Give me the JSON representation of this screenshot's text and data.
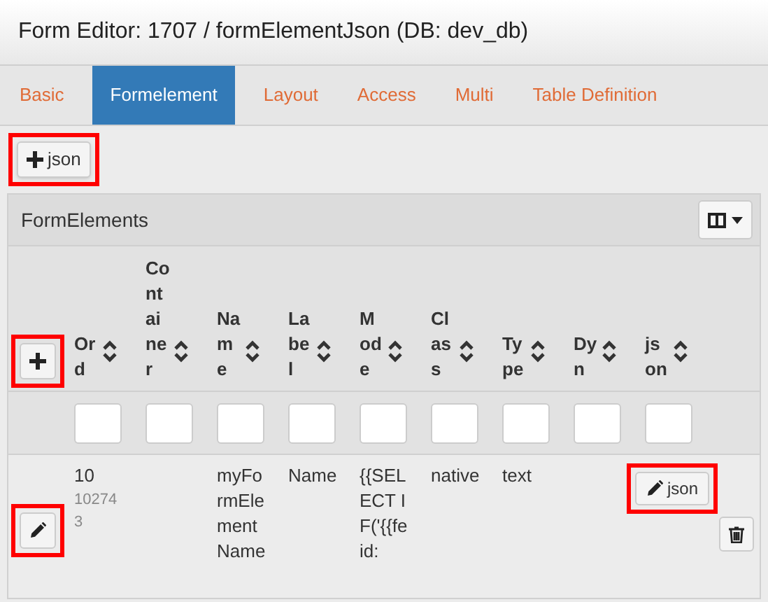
{
  "window": {
    "title": "Form Editor: 1707 / formElementJson (DB: dev_db)"
  },
  "tabs": [
    {
      "label": "Basic",
      "selected": false
    },
    {
      "label": "Formelement",
      "selected": true
    },
    {
      "label": "Layout",
      "selected": false
    },
    {
      "label": "Access",
      "selected": false
    },
    {
      "label": "Multi",
      "selected": false
    },
    {
      "label": "Table Definition",
      "selected": false
    }
  ],
  "toolbar": {
    "add_json_button": {
      "label": "json",
      "highlighted": true
    }
  },
  "panel": {
    "title": "FormElements",
    "add_button": {
      "highlighted": true
    },
    "columns": [
      "Ord",
      "Container",
      "Name",
      "Label",
      "Mode",
      "Class",
      "Type",
      "Dyn",
      "json"
    ],
    "rows": [
      {
        "edit_button": {
          "highlighted": true
        },
        "json_button": {
          "label": "json",
          "highlighted": true
        },
        "cells": [
          {
            "text": "10",
            "subtext": "102743"
          },
          {
            "text": ""
          },
          {
            "text": "myFormElementName"
          },
          {
            "text": "Name"
          },
          {
            "text": "{{SELECT IF('{{feid:"
          },
          {
            "text": "native"
          },
          {
            "text": "text"
          },
          {
            "text": ""
          },
          {
            "text": ""
          }
        ]
      }
    ]
  }
}
